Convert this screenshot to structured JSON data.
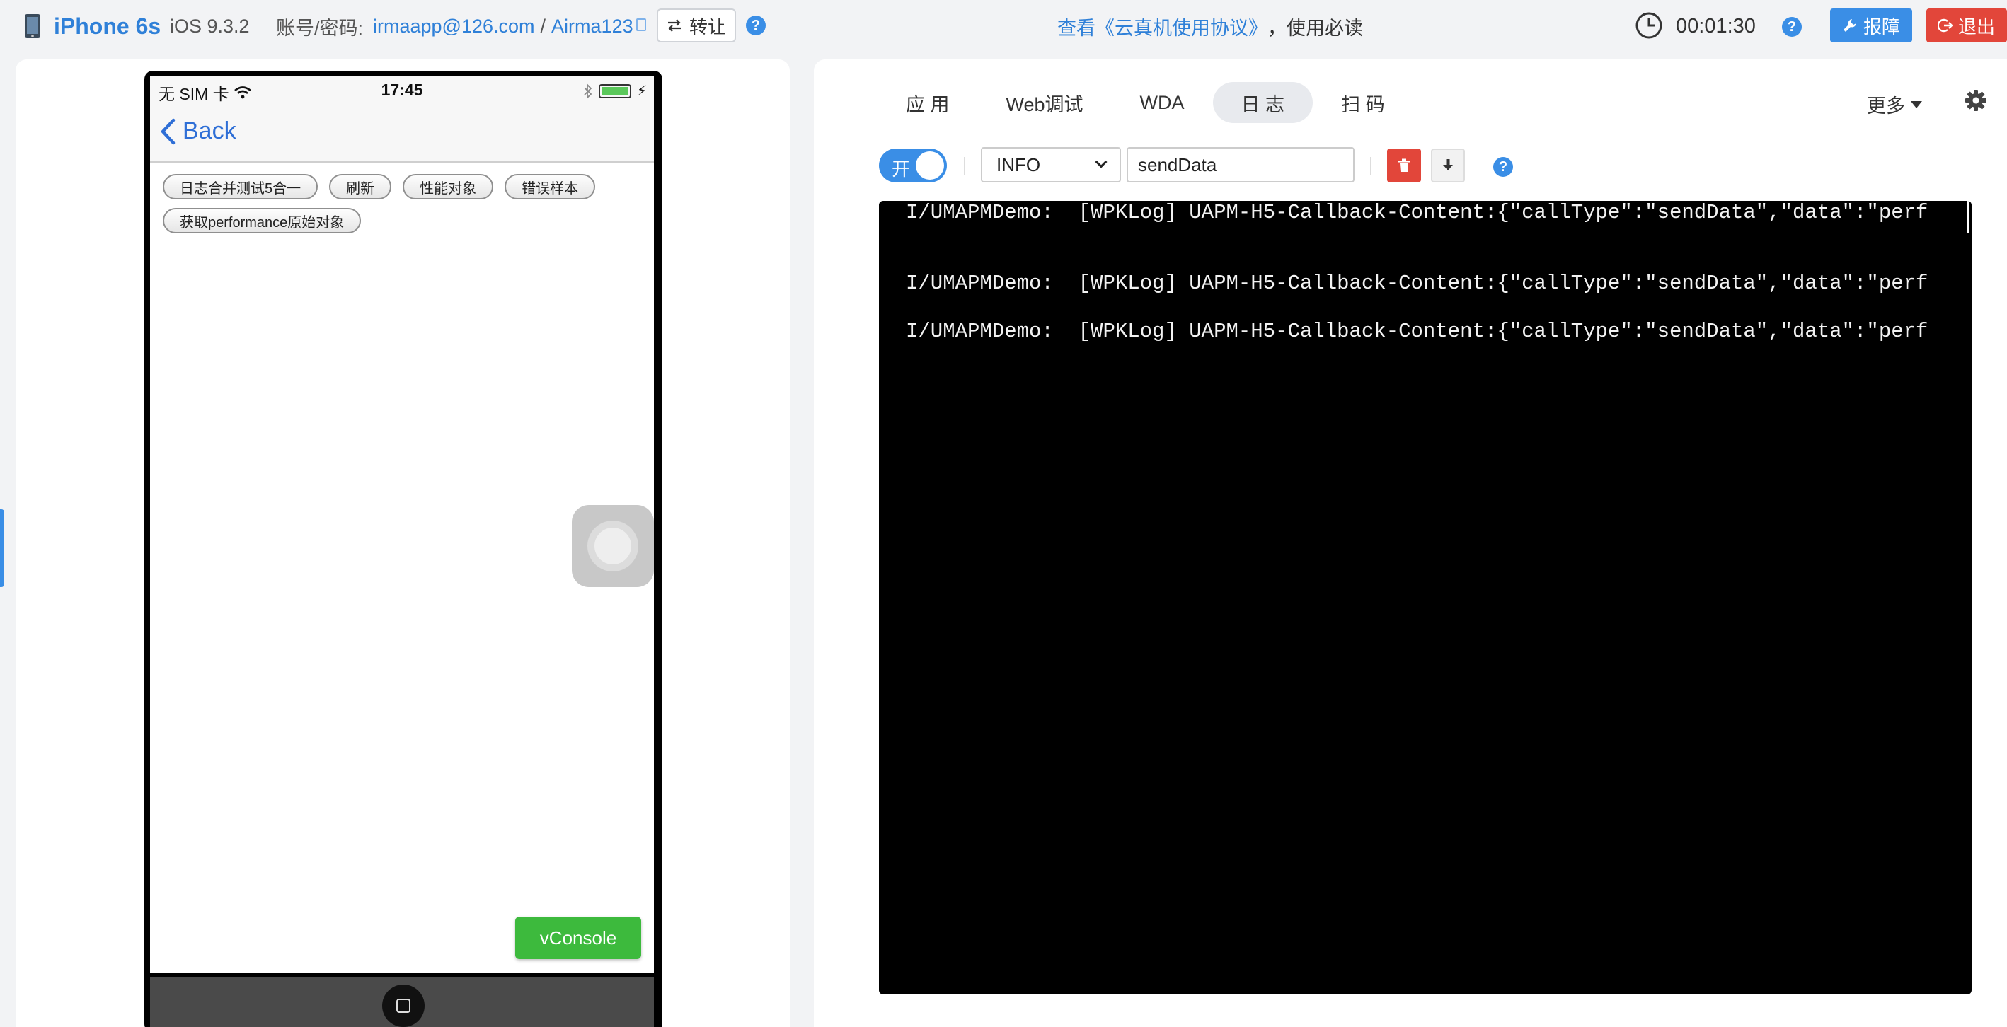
{
  "header": {
    "device_name": "iPhone 6s",
    "os_version": "iOS 9.3.2",
    "account_label": "账号/密码:",
    "account_email": "irmaapp@126.com",
    "account_separator": "/",
    "account_password": "Airma123",
    "transfer_label": "转让",
    "notice_link": "查看《云真机使用协议》",
    "notice_suffix": "，使用必读",
    "timer": "00:01:30",
    "report_label": "报障",
    "logout_label": "退出",
    "help_glyph": "?"
  },
  "phone": {
    "status_carrier": "无 SIM 卡",
    "status_time": "17:45",
    "back_label": "Back",
    "buttons": [
      "日志合并测试5合一",
      "刷新",
      "性能对象",
      "错误样本",
      "获取performance原始对象"
    ],
    "vconsole_label": "vConsole"
  },
  "tabs": [
    {
      "label": "应 用",
      "active": false
    },
    {
      "label": "Web调试",
      "active": false
    },
    {
      "label": "WDA",
      "active": false
    },
    {
      "label": "日 志",
      "active": true
    },
    {
      "label": "扫 码",
      "active": false
    }
  ],
  "more_label": "更多",
  "log_toolbar": {
    "toggle_label": "开",
    "level": "INFO",
    "filter_value": "sendData"
  },
  "logs": [
    "I/UMAPMDemo:  [WPKLog] UAPM-H5-Callback-Content:{\"callType\":\"sendData\",\"data\":\"perf",
    "I/UMAPMDemo:  [WPKLog] UAPM-H5-Callback-Content:{\"callType\":\"sendData\",\"data\":\"perf",
    "I/UMAPMDemo:  [WPKLog] UAPM-H5-Callback-Content:{\"callType\":\"sendData\",\"data\":\"perf"
  ],
  "colors": {
    "accent": "#3a8ee6",
    "danger": "#e2463a",
    "vconsole": "#3dba3d",
    "console_bg": "#000000"
  },
  "icons": [
    "phone-icon",
    "copy-icon",
    "transfer-icon",
    "help-icon",
    "clock-icon",
    "wrench-icon",
    "logout-icon",
    "wifi-icon",
    "bluetooth-icon",
    "battery-icon",
    "chevron-left-icon",
    "caret-down-icon",
    "gear-icon",
    "trash-icon",
    "download-icon"
  ]
}
